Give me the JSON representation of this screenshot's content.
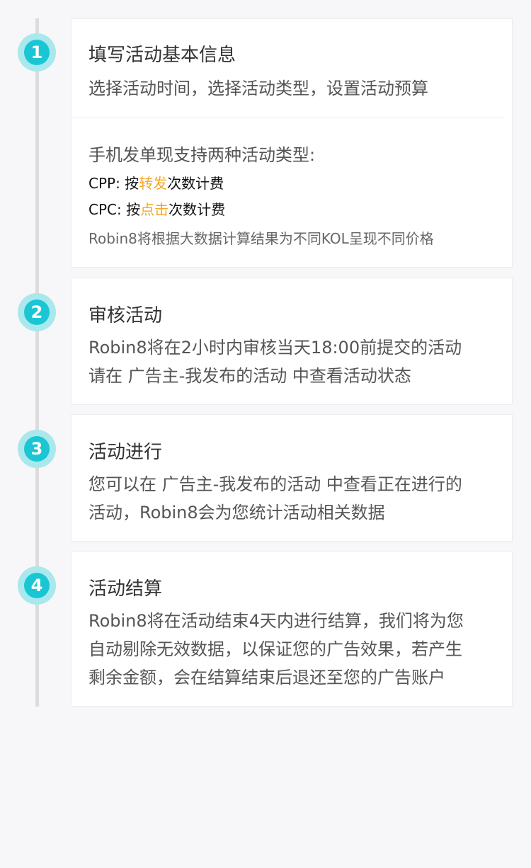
{
  "steps": [
    {
      "number": "1",
      "title": "填写活动基本信息",
      "line1": "选择活动时间，选择活动类型，设置活动预算",
      "types_intro": "手机发单现支持两种活动类型:",
      "cpp": {
        "prefix": "CPP: 按",
        "highlight": "转发",
        "suffix": "次数计费"
      },
      "cpc": {
        "prefix": "CPC: 按",
        "highlight": "点击",
        "suffix": "次数计费"
      },
      "note": "Robin8将根据大数据计算结果为不同KOL呈现不同价格"
    },
    {
      "number": "2",
      "title": "审核活动",
      "line1": "Robin8将在2小时内审核当天18:00前提交的活动",
      "line2": "请在 广告主-我发布的活动 中查看活动状态"
    },
    {
      "number": "3",
      "title": "活动进行",
      "line1": "您可以在 广告主-我发布的活动 中查看正在进行的",
      "line2": "活动，Robin8会为您统计活动相关数据"
    },
    {
      "number": "4",
      "title": "活动结算",
      "line1": "Robin8将在活动结束4天内进行结算，我们将为您",
      "line2": "自动剔除无效数据，以保证您的广告效果，若产生",
      "line3": "剩余金额，会在结算结束后退还至您的广告账户"
    }
  ],
  "colors": {
    "accent": "#1ac6d4",
    "accent_ring": "#a9e8ec",
    "highlight": "#f5a623",
    "background": "#f7f7f9"
  }
}
